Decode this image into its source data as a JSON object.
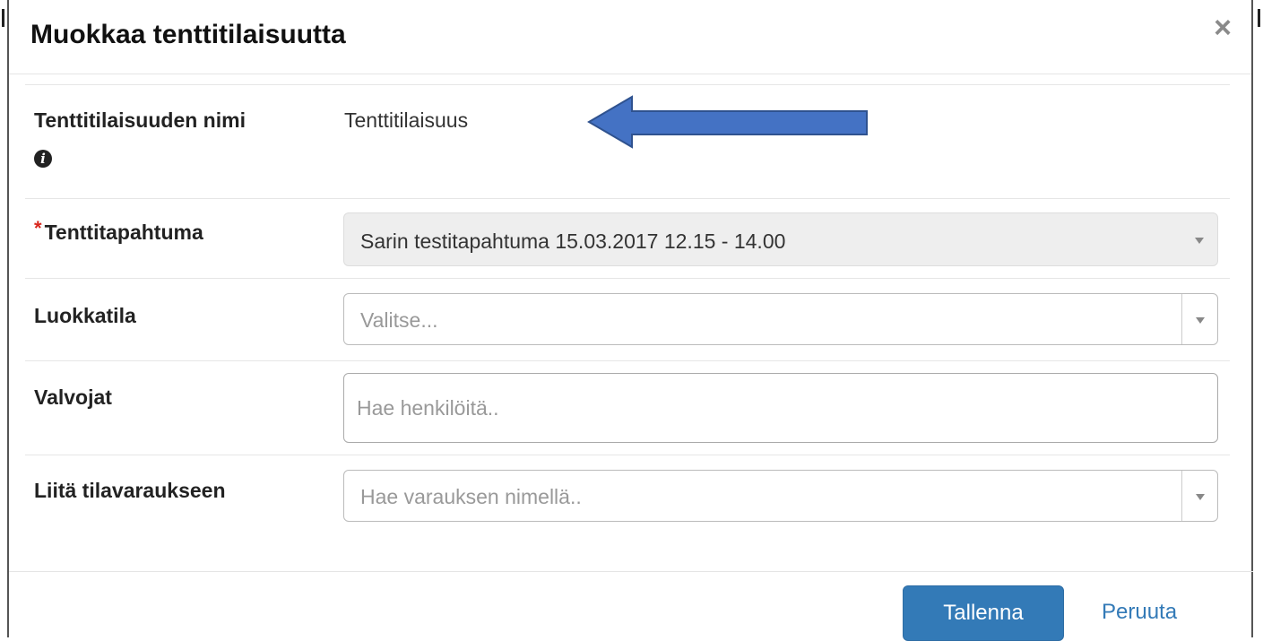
{
  "modal": {
    "title": "Muokkaa tenttitilaisuutta",
    "close_glyph": "×"
  },
  "form": {
    "name_row": {
      "label": "Tenttitilaisuuden nimi",
      "info_icon": "info-circle-icon",
      "value": "Tenttitilaisuus"
    },
    "event_row": {
      "required_marker": "*",
      "label": "Tenttitapahtuma",
      "selected": "Sarin testitapahtuma 15.03.2017 12.15 - 14.00",
      "disabled": true
    },
    "room_row": {
      "label": "Luokkatila",
      "placeholder": "Valitse..."
    },
    "supervisors_row": {
      "label": "Valvojat",
      "placeholder": "Hae henkilöitä.."
    },
    "reservation_row": {
      "label": "Liitä tilavaraukseen",
      "placeholder": "Hae varauksen nimellä.."
    }
  },
  "footer": {
    "save_label": "Tallenna",
    "cancel_label": "Peruuta"
  },
  "annotation": {
    "arrow_icon": "left-arrow-icon",
    "arrow_fill": "#4472c4",
    "arrow_stroke": "#2f528f"
  },
  "colors": {
    "primary": "#337ab7",
    "required": "#d9261c"
  }
}
